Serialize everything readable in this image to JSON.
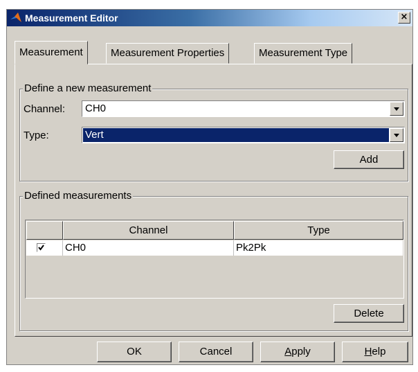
{
  "window": {
    "title": "Measurement Editor",
    "close_glyph": "×",
    "icon": "matlab-logo-icon"
  },
  "tabs": [
    {
      "label": "Measurement",
      "active": true
    },
    {
      "label": "Measurement Properties",
      "active": false
    },
    {
      "label": "Measurement Type",
      "active": false
    }
  ],
  "define_group": {
    "legend": "Define a new measurement",
    "channel_label": "Channel:",
    "channel_value": "CH0",
    "type_label": "Type:",
    "type_value": "Vert",
    "add_label": "Add"
  },
  "defined_group": {
    "legend": "Defined measurements",
    "columns": [
      "",
      "Channel",
      "Type"
    ],
    "rows": [
      {
        "checked": true,
        "channel": "CH0",
        "type": "Pk2Pk"
      }
    ],
    "delete_label": "Delete"
  },
  "footer": {
    "ok_label": "OK",
    "cancel_label": "Cancel",
    "apply_label": "Apply",
    "help_label": "Help"
  },
  "colors": {
    "selection": "#0a246a",
    "dialog_bg": "#d4d0c8"
  }
}
